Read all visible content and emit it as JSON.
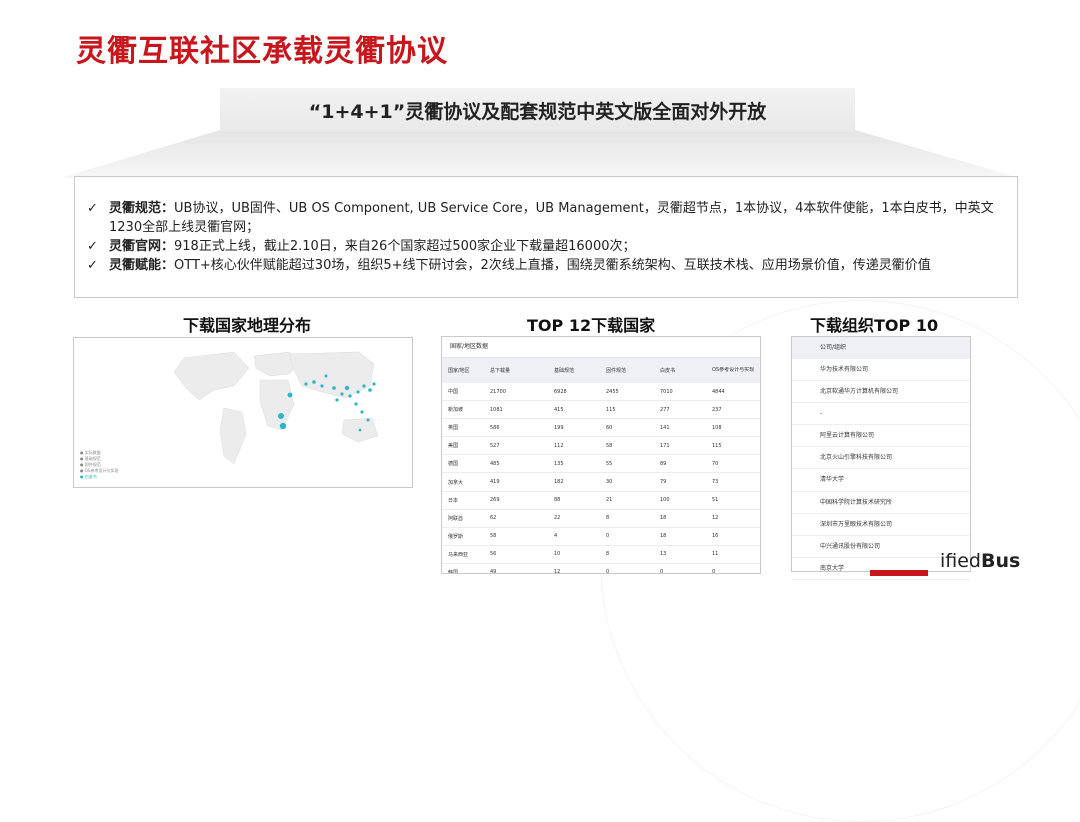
{
  "slide": {
    "title": "灵衢互联社区承载灵衢协议",
    "banner": "“1+4+1”灵衢协议及配套规范中英文版全面对外开放"
  },
  "bullets": [
    {
      "check": "✓",
      "label": "灵衢规范：",
      "text": "UB协议，UB固件、UB OS Component, UB Service Core，UB Management，灵衢超节点，1本协议，4本软件使能，1本白皮书，中英文1230全部上线灵衢官网；"
    },
    {
      "check": "✓",
      "label": "灵衢官网：",
      "text": "918正式上线，截止2.10日，来自26个国家超过500家企业下载量超16000次；"
    },
    {
      "check": "✓",
      "label": "灵衢赋能：",
      "text": "OTT+核心伙伴赋能超过30场，组织5+线下研讨会，2次线上直播，围绕灵衢系统架构、互联技术栈、应用场景价值，传递灵衢价值"
    }
  ],
  "sections": {
    "map_title": "下载国家地理分布",
    "top12_title": "TOP 12下载国家",
    "org_title": "下载组织TOP 10"
  },
  "map": {
    "legend": [
      "实际数据",
      "基础规范",
      "固件规范",
      "OS参考设计与实现",
      "白皮书"
    ]
  },
  "country_table": {
    "header": "国家/地区数据",
    "columns": [
      "国家/地区",
      "总下载量",
      "基础规范",
      "固件规范",
      "白皮书",
      "OS参考设计与实现"
    ],
    "rows": [
      [
        "中国",
        "21700",
        "6928",
        "2455",
        "7010",
        "4844"
      ],
      [
        "新加坡",
        "1081",
        "415",
        "115",
        "277",
        "237"
      ],
      [
        "英国",
        "586",
        "199",
        "60",
        "141",
        "108"
      ],
      [
        "美国",
        "527",
        "112",
        "58",
        "171",
        "115"
      ],
      [
        "德国",
        "485",
        "135",
        "55",
        "89",
        "70"
      ],
      [
        "加拿大",
        "419",
        "182",
        "30",
        "79",
        "73"
      ],
      [
        "日本",
        "269",
        "88",
        "21",
        "100",
        "51"
      ],
      [
        "阿联酋",
        "62",
        "22",
        "8",
        "18",
        "12"
      ],
      [
        "俄罗斯",
        "58",
        "4",
        "0",
        "18",
        "16"
      ],
      [
        "马来西亚",
        "56",
        "10",
        "8",
        "13",
        "11"
      ],
      [
        "韩国",
        "49",
        "12",
        "0",
        "0",
        "0"
      ]
    ]
  },
  "org_table": {
    "header": "公司/组织",
    "rows": [
      "华为技术有限公司",
      "北京软通华方计算机有限公司",
      "-",
      "阿里云计算有限公司",
      "北京火山引擎科技有限公司",
      "清华大学",
      "中国科学院计算技术研究所",
      "深圳市万里眼技术有限公司",
      "中兴通讯股份有限公司",
      "南京大学"
    ]
  },
  "brand": {
    "prefix": "ified",
    "bold": "Bus"
  },
  "colors": {
    "accent": "#c8161d",
    "map_dot": "#2bb5c9"
  }
}
